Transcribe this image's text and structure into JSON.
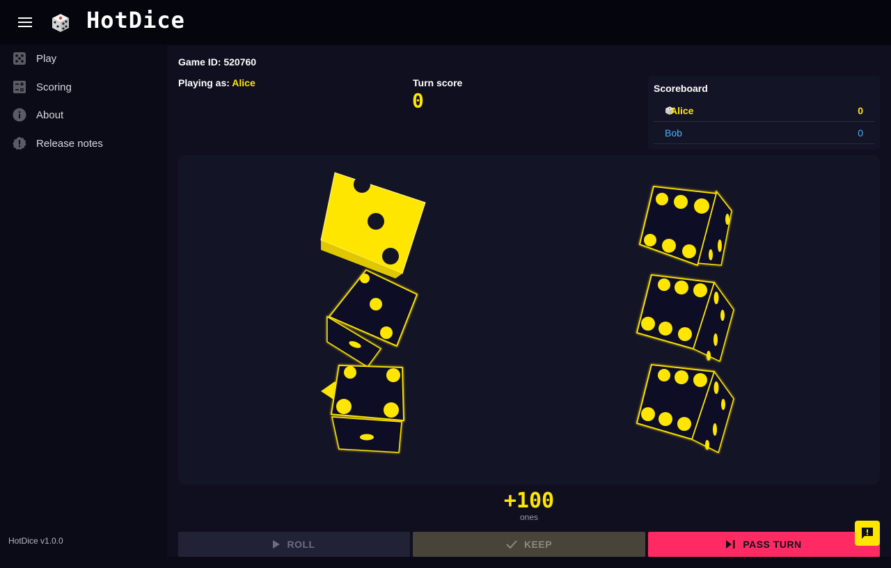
{
  "app": {
    "title": "HotDice",
    "version": "HotDice v1.0.0"
  },
  "sidebar": {
    "items": [
      {
        "label": "Play",
        "icon": "dice-icon"
      },
      {
        "label": "Scoring",
        "icon": "calculator-icon"
      },
      {
        "label": "About",
        "icon": "info-icon"
      },
      {
        "label": "Release notes",
        "icon": "badge-alert-icon"
      }
    ]
  },
  "game": {
    "id_label": "Game ID:",
    "id_value": "520760",
    "playing_as_label": "Playing as:",
    "player": "Alice",
    "turn_score_label": "Turn score",
    "turn_score": "0"
  },
  "scoreboard": {
    "title": "Scoreboard",
    "players": [
      {
        "name": "Alice",
        "score": "0",
        "active": true,
        "color": "#ffe600"
      },
      {
        "name": "Bob",
        "score": "0",
        "active": false,
        "color": "#45b6ff"
      }
    ]
  },
  "dice": {
    "kept": [
      3
    ],
    "rolled": [
      1,
      4,
      6,
      6,
      6
    ],
    "accent": "#ffe600"
  },
  "result": {
    "points": "+100",
    "label": "ones"
  },
  "actions": {
    "roll": "ROLL",
    "keep": "KEEP",
    "pass": "PASS TURN"
  },
  "colors": {
    "accent": "#ffe600",
    "pass": "#ff2a63",
    "background": "#0f0f1f"
  }
}
